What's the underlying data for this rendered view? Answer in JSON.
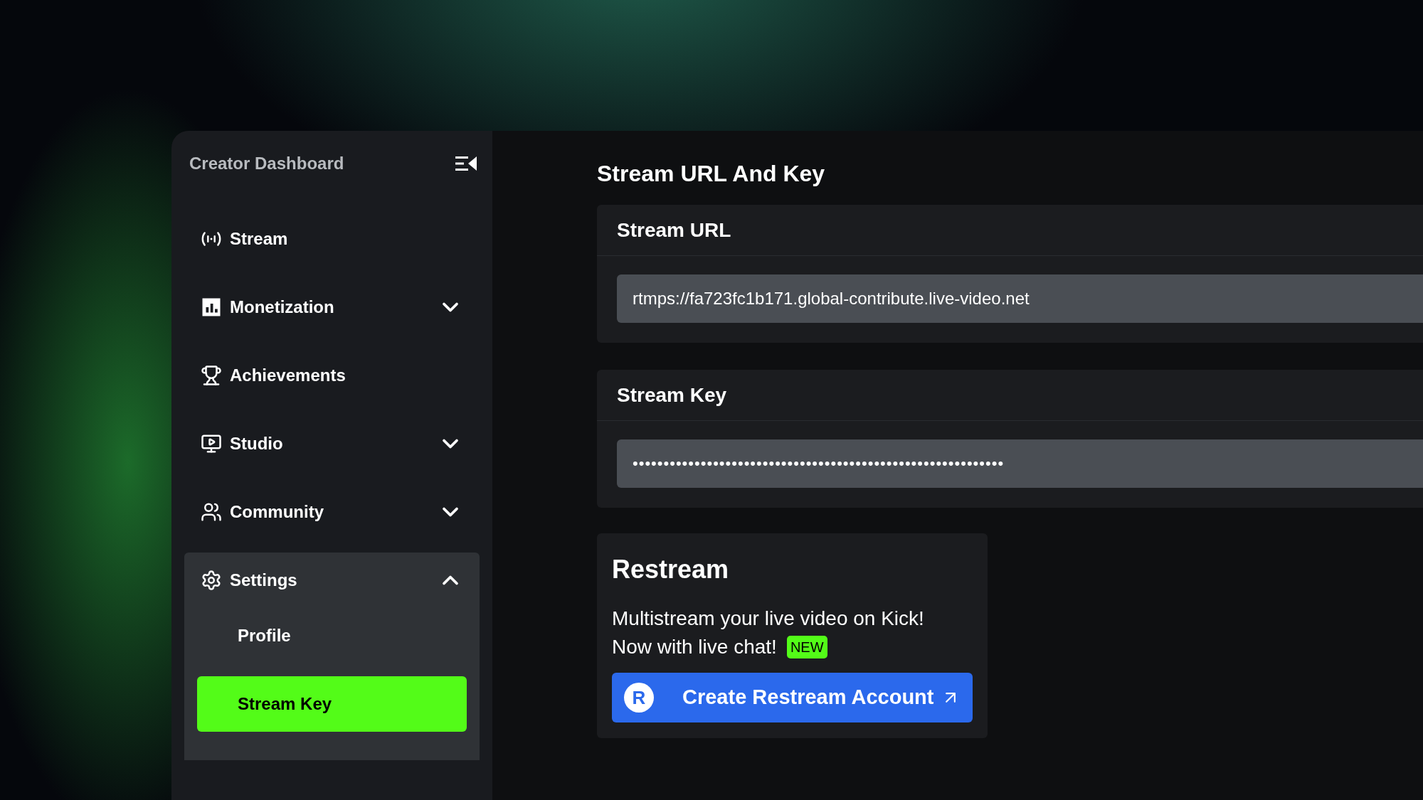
{
  "sidebar": {
    "title": "Creator Dashboard",
    "items": [
      {
        "label": "Stream",
        "selected": false
      },
      {
        "label": "Monetization",
        "selected": false,
        "expanded": false
      },
      {
        "label": "Achievements",
        "selected": false
      },
      {
        "label": "Studio",
        "selected": false,
        "expanded": false
      },
      {
        "label": "Community",
        "selected": false,
        "expanded": false
      },
      {
        "label": "Settings",
        "selected": false,
        "expanded": true,
        "children": [
          {
            "label": "Profile",
            "selected": false
          },
          {
            "label": "Stream Key",
            "selected": true
          }
        ]
      }
    ]
  },
  "main": {
    "title": "Stream URL And Key",
    "sections": [
      {
        "title": "Stream URL",
        "value": "rtmps://fa723fc1b171.global-contribute.live-video.net"
      },
      {
        "title": "Stream Key",
        "value": "••••••••••••••••••••••••••••••••••••••••••••••••••••••••••••"
      }
    ],
    "restream": {
      "title": "Restream",
      "line_1": "Multistream your live video on Kick!",
      "line_2": "Now with live chat!",
      "badge": "NEW",
      "button": "Create Restream Account",
      "logo_letter": "R"
    }
  }
}
